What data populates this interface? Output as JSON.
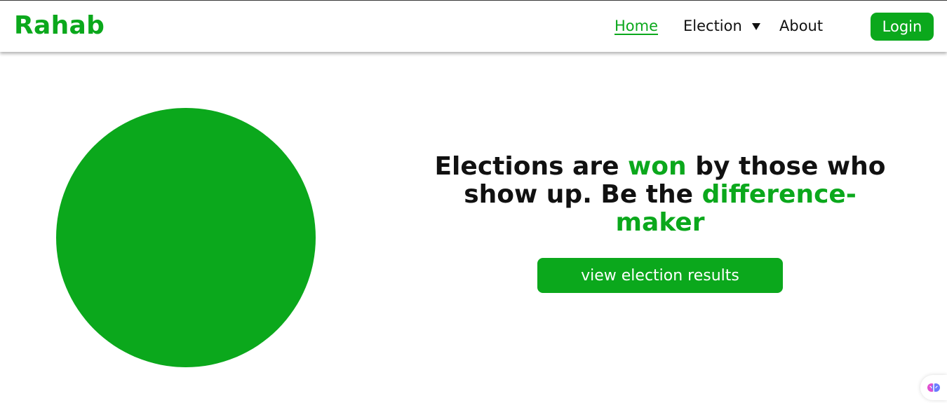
{
  "brand": {
    "name": "Rahab"
  },
  "nav": {
    "home": "Home",
    "election": "Election",
    "about": "About",
    "login": "Login"
  },
  "hero": {
    "headline_part1": "Elections are ",
    "headline_accent1": "won",
    "headline_part2": " by those who show up. Be the ",
    "headline_accent2": "difference-maker",
    "cta": "view election results"
  },
  "colors": {
    "brand_green": "#0ba81c",
    "text": "#111111",
    "background": "#ffffff"
  },
  "icons": {
    "dropdown": "caret-down-icon",
    "extension": "brain-icon"
  }
}
